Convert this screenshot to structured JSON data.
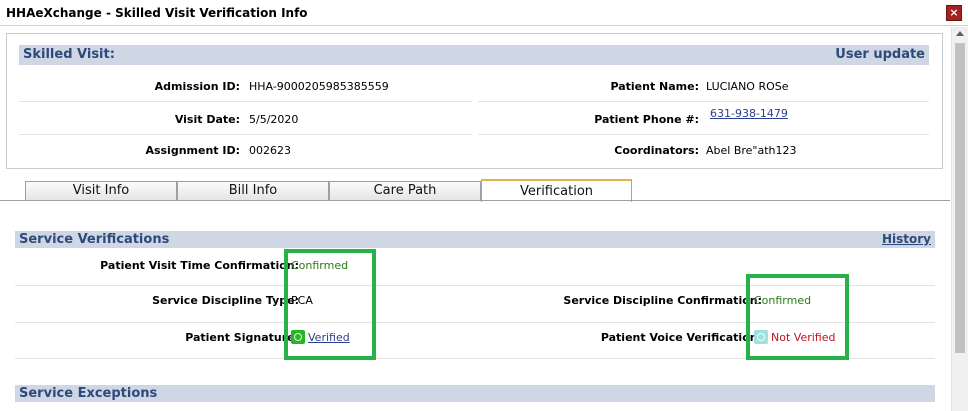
{
  "window": {
    "title": "HHAeXchange - Skilled Visit Verification Info",
    "close_glyph": "×"
  },
  "visit": {
    "header": "Skilled Visit:",
    "user_update": "User update",
    "admission_id_label": "Admission ID:",
    "admission_id": "HHA-9000205985385559",
    "patient_name_label": "Patient Name:",
    "patient_name": "LUCIANO ROSe",
    "visit_date_label": "Visit Date:",
    "visit_date": "5/5/2020",
    "patient_phone_label": "Patient Phone #:",
    "patient_phone": "631-938-1479",
    "assignment_id_label": "Assignment ID:",
    "assignment_id": "002623",
    "coordinators_label": "Coordinators:",
    "coordinators": "Abel Bre\"ath123"
  },
  "tabs": [
    {
      "label": "Visit Info",
      "active": false
    },
    {
      "label": "Bill Info",
      "active": false
    },
    {
      "label": "Care Path",
      "active": false
    },
    {
      "label": "Verification",
      "active": true
    }
  ],
  "service_verifications": {
    "header": "Service Verifications",
    "history_link": "History",
    "visit_time_label": "Patient Visit Time Confirmation:",
    "visit_time_value": "Confirmed",
    "discipline_type_label": "Service Discipline Type:",
    "discipline_type_value": "PCA",
    "discipline_confirmation_label": "Service Discipline Confirmation:",
    "discipline_confirmation_value": "Confirmed",
    "signature_label": "Patient Signature:",
    "signature_value": "Verified",
    "voice_label": "Patient Voice Verification:",
    "voice_value": "Not Verified"
  },
  "service_exceptions": {
    "header": "Service Exceptions"
  },
  "colors": {
    "section_header_bg": "#cfd6e4",
    "section_header_text": "#2d4a7a",
    "confirmed": "#2a7a18",
    "not_verified": "#c0141c",
    "highlight_box": "#28b04a",
    "signature_icon": "#29b524",
    "voice_icon": "#9fe0e0"
  },
  "icons": {
    "signature": "signature-verified-icon",
    "voice": "voice-unverified-icon"
  }
}
